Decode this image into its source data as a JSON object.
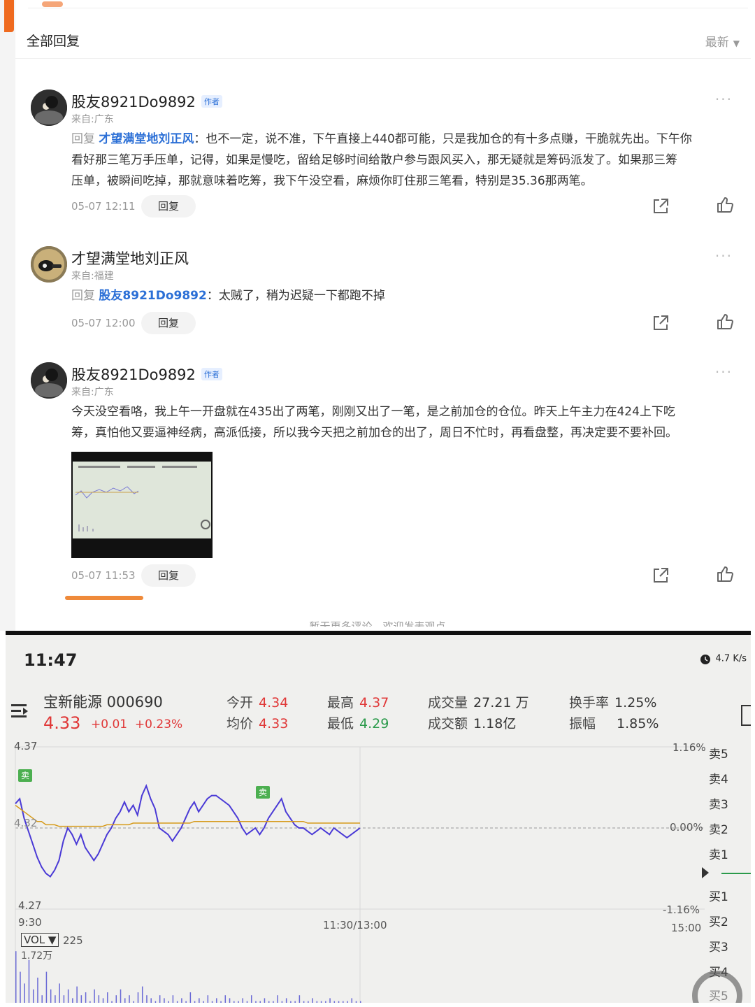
{
  "thread": {
    "header_title": "全部回复",
    "sort_label": "最新",
    "author_tag": "作者",
    "reply_prefix": "回复",
    "reply_button": "回复",
    "footer_text": "暂无更多评论，欢迎发表观点",
    "comments": [
      {
        "user": "股友8921Do9892",
        "is_author": true,
        "from": "来自:广东",
        "reply_to": "才望满堂地刘正风",
        "text_lines": [
          "：也不一定，说不准，下午直接上440都可能，只是我加仓的有十多点赚，干脆就先出。下午你",
          "看好那三笔万手压单，记得，如果是慢吃，留给足够时间给散户参与跟风买入，那无疑就是筹码派发了。如果那三筹",
          "压单，被瞬间吃掉，那就意味着吃筹，我下午没空看，麻烦你盯住那三笔看，特别是35.36那两笔。"
        ],
        "time": "05-07 12:11"
      },
      {
        "user": "才望满堂地刘正风",
        "is_author": false,
        "from": "来自:福建",
        "reply_to": "股友8921Do9892",
        "text_lines": [
          "：太贼了，稍为迟疑一下都跑不掉"
        ],
        "time": "05-07 12:00"
      },
      {
        "user": "股友8921Do9892",
        "is_author": true,
        "from": "来自:广东",
        "text_lines": [
          "今天没空看咯，我上午一开盘就在435出了两笔，刚刚又出了一笔，是之前加仓的仓位。昨天上午主力在424上下吃",
          "筹，真怕他又要逼神经病，高派低接，所以我今天把之前加仓的出了，周日不忙时，再看盘整，再决定要不要补回。"
        ],
        "time": "05-07 11:53"
      }
    ]
  },
  "screen": {
    "clock": "11:47",
    "net_speed": "4.7 K/s",
    "stock_name": "宝新能源 000690",
    "price": "4.33",
    "change": "+0.01",
    "change_pct": "+0.23%",
    "stats": {
      "open_label": "今开",
      "open": "4.34",
      "avg_label": "均价",
      "avg": "4.33",
      "high_label": "最高",
      "high": "4.37",
      "low_label": "最低",
      "low": "4.29",
      "vol_label": "成交量",
      "vol": "27.21 万",
      "amt_label": "成交额",
      "amt": "1.18亿",
      "turnover_label": "换手率",
      "turnover": "1.25%",
      "amp_label": "振幅",
      "amp": "1.85%"
    },
    "axis": {
      "y_top": "4.37",
      "y_mid": "4.32",
      "y_bottom": "4.27",
      "pct_top": "1.16%",
      "pct_mid": "0.00%",
      "pct_bottom": "-1.16%",
      "t_start": "9:30",
      "t_mid": "11:30/13:00",
      "t_end": "15:00"
    },
    "marker_label": "卖",
    "sell_levels": [
      "卖5",
      "卖4",
      "卖3",
      "卖2",
      "卖1"
    ],
    "buy_levels": [
      "买1",
      "买2",
      "买3",
      "买4",
      "买5"
    ],
    "vol_box": "VOL ▼",
    "vol_value": "225",
    "vol_scale": "1.72万"
  },
  "chart_data": {
    "type": "line",
    "title": "",
    "xlabel": "",
    "ylabel": "",
    "ylim": [
      4.27,
      4.37
    ],
    "x_range": [
      "9:30",
      "15:00"
    ],
    "prev_close": 4.32,
    "series": [
      {
        "color": "#4a3ad6",
        "values": [
          4.335,
          4.338,
          4.326,
          4.318,
          4.31,
          4.302,
          4.296,
          4.292,
          4.29,
          4.294,
          4.3,
          4.312,
          4.32,
          4.316,
          4.31,
          4.316,
          4.308,
          4.304,
          4.3,
          4.304,
          4.31,
          4.316,
          4.32,
          4.326,
          4.33,
          4.336,
          4.33,
          4.334,
          4.328,
          4.34,
          4.346,
          4.338,
          4.332,
          4.32,
          4.318,
          4.316,
          4.312,
          4.316,
          4.32,
          4.326,
          4.332,
          4.336,
          4.33,
          4.334,
          4.338,
          4.34,
          4.34,
          4.338,
          4.336,
          4.334,
          4.33,
          4.326,
          4.32,
          4.316,
          4.318,
          4.32,
          4.316,
          4.32,
          4.326,
          4.33,
          4.334,
          4.338,
          4.33,
          4.326,
          4.322,
          4.32,
          4.32,
          4.318,
          4.316,
          4.318,
          4.32,
          4.318,
          4.316,
          4.32,
          4.318,
          4.316,
          4.314,
          4.316,
          4.318,
          4.32
        ]
      },
      {
        "color": "#d69a1a",
        "values": [
          4.334,
          4.332,
          4.33,
          4.328,
          4.326,
          4.324,
          4.324,
          4.322,
          4.322,
          4.322,
          4.321,
          4.321,
          4.321,
          4.321,
          4.321,
          4.321,
          4.321,
          4.321,
          4.321,
          4.321,
          4.321,
          4.322,
          4.322,
          4.322,
          4.322,
          4.322,
          4.322,
          4.323,
          4.323,
          4.323,
          4.323,
          4.323,
          4.323,
          4.323,
          4.323,
          4.323,
          4.323,
          4.323,
          4.323,
          4.323,
          4.323,
          4.324,
          4.324,
          4.324,
          4.324,
          4.324,
          4.324,
          4.324,
          4.324,
          4.324,
          4.324,
          4.324,
          4.324,
          4.324,
          4.324,
          4.324,
          4.324,
          4.324,
          4.324,
          4.324,
          4.324,
          4.324,
          4.324,
          4.324,
          4.324,
          4.324,
          4.324,
          4.323,
          4.323,
          4.323,
          4.323,
          4.323,
          4.323,
          4.323,
          4.323,
          4.323,
          4.323,
          4.323,
          4.323,
          4.323
        ]
      }
    ],
    "volume": [
      0.95,
      0.6,
      0.4,
      0.8,
      0.3,
      0.5,
      0.2,
      0.6,
      0.3,
      0.2,
      0.4,
      0.2,
      0.3,
      0.15,
      0.35,
      0.2,
      0.25,
      0.1,
      0.3,
      0.2,
      0.15,
      0.25,
      0.1,
      0.2,
      0.3,
      0.15,
      0.2,
      0.1,
      0.25,
      0.35,
      0.2,
      0.15,
      0.1,
      0.2,
      0.15,
      0.1,
      0.2,
      0.1,
      0.15,
      0.1,
      0.25,
      0.1,
      0.15,
      0.1,
      0.2,
      0.1,
      0.15,
      0.1,
      0.2,
      0.15,
      0.1,
      0.1,
      0.15,
      0.1,
      0.2,
      0.1,
      0.1,
      0.15,
      0.1,
      0.1,
      0.2,
      0.1,
      0.15,
      0.1,
      0.1,
      0.2,
      0.1,
      0.1,
      0.15,
      0.1,
      0.1,
      0.1,
      0.15,
      0.1,
      0.1,
      0.1,
      0.1,
      0.15,
      0.1,
      0.1
    ]
  }
}
